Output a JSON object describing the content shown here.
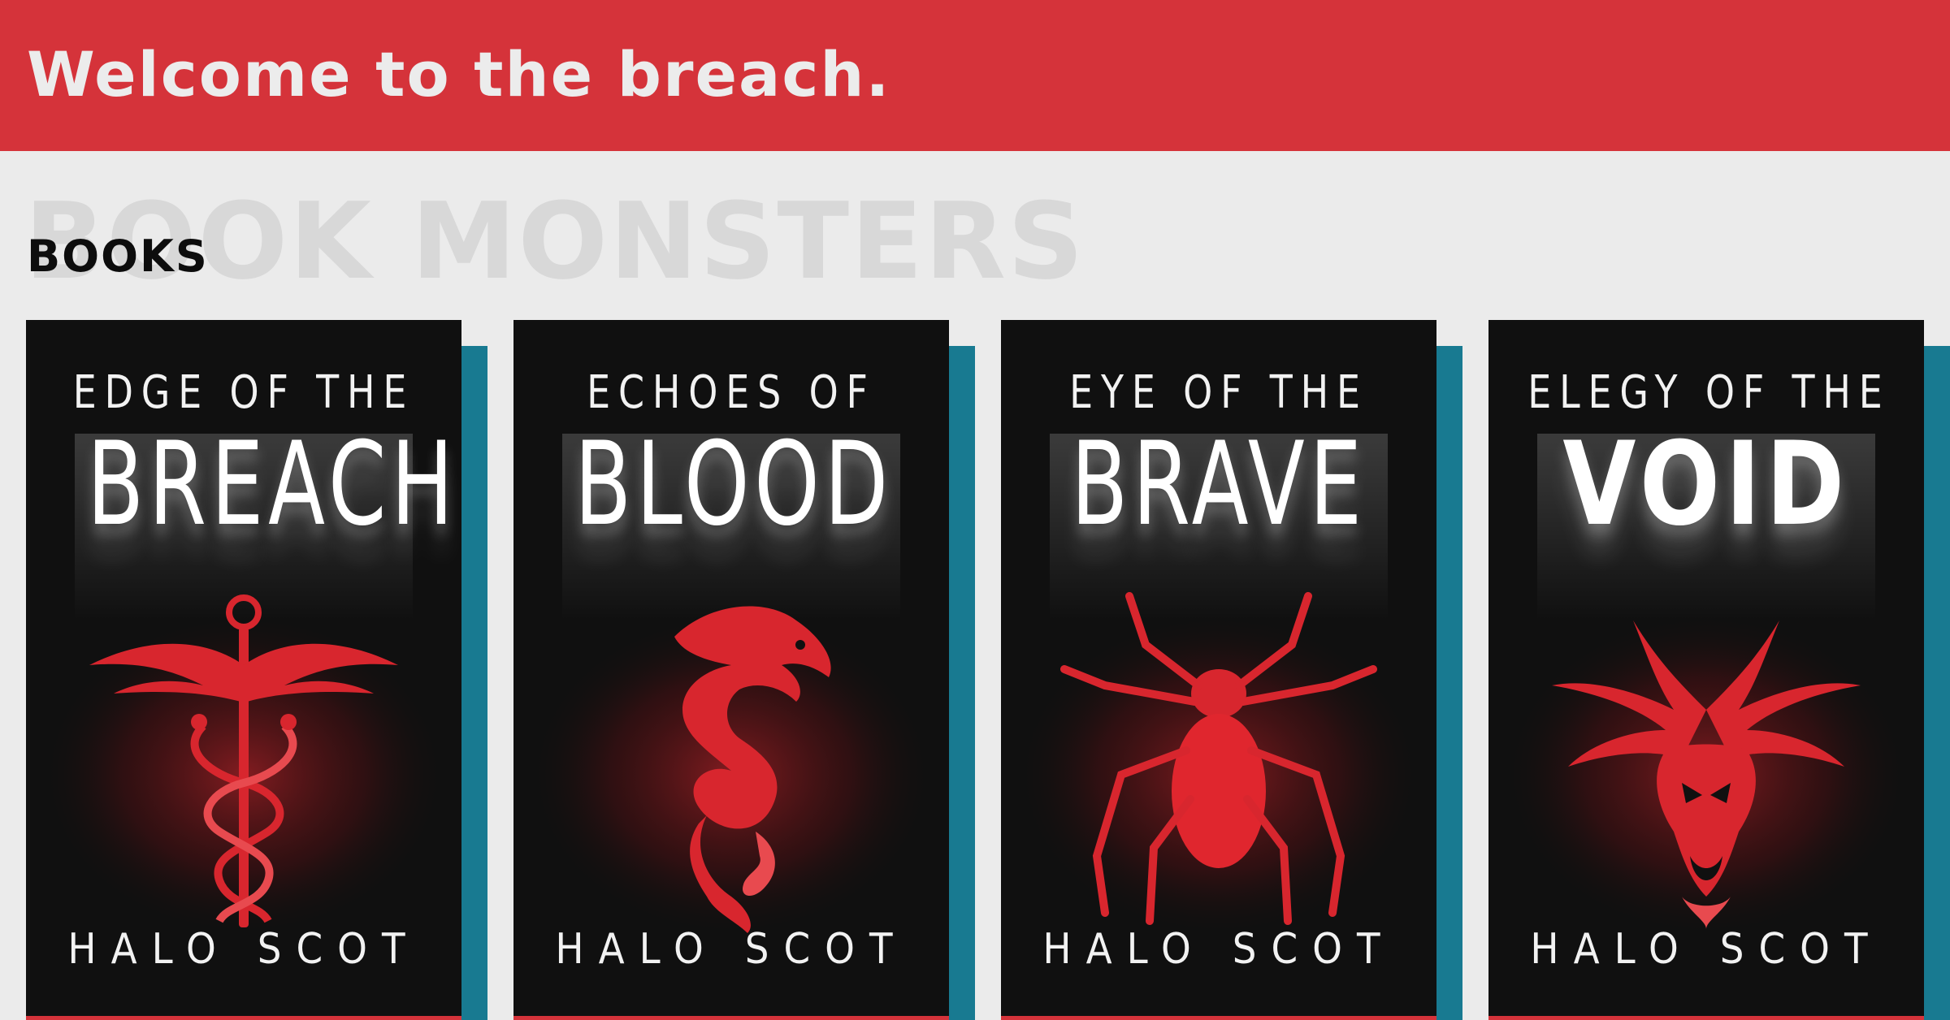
{
  "banner": {
    "title": "Welcome to the breach.",
    "color": "#d5333a"
  },
  "section": {
    "background_word": "BOOK MONSTERS",
    "label": "BOOKS"
  },
  "accent_shadow_color": "#187a91",
  "books": [
    {
      "title_line1": "EDGE OF THE",
      "title_line2": "BREACH",
      "author": "HALO SCOT",
      "emblem": "caduceus-icon"
    },
    {
      "title_line1": "ECHOES OF",
      "title_line2": "BLOOD",
      "author": "HALO SCOT",
      "emblem": "dragon-icon"
    },
    {
      "title_line1": "EYE OF THE",
      "title_line2": "BRAVE",
      "author": "HALO SCOT",
      "emblem": "spider-icon"
    },
    {
      "title_line1": "ELEGY OF THE",
      "title_line2": "VOID",
      "author": "HALO SCOT",
      "emblem": "dragon-head-icon"
    }
  ]
}
